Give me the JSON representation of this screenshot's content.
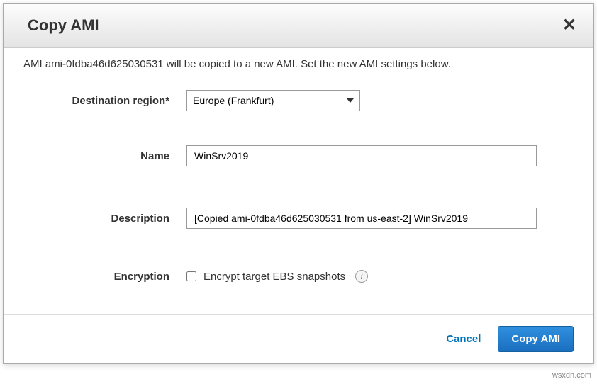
{
  "dialog": {
    "title": "Copy AMI",
    "intro": "AMI ami-0fdba46d625030531 will be copied to a new AMI. Set the new AMI settings below."
  },
  "form": {
    "region_label": "Destination region*",
    "region_value": "Europe (Frankfurt)",
    "name_label": "Name",
    "name_value": "WinSrv2019",
    "description_label": "Description",
    "description_value": "[Copied ami-0fdba46d625030531 from us-east-2] WinSrv2019",
    "encryption_label": "Encryption",
    "encryption_checkbox_label": "Encrypt target EBS snapshots"
  },
  "footer": {
    "cancel": "Cancel",
    "submit": "Copy AMI"
  },
  "watermark": "wsxdn.com"
}
